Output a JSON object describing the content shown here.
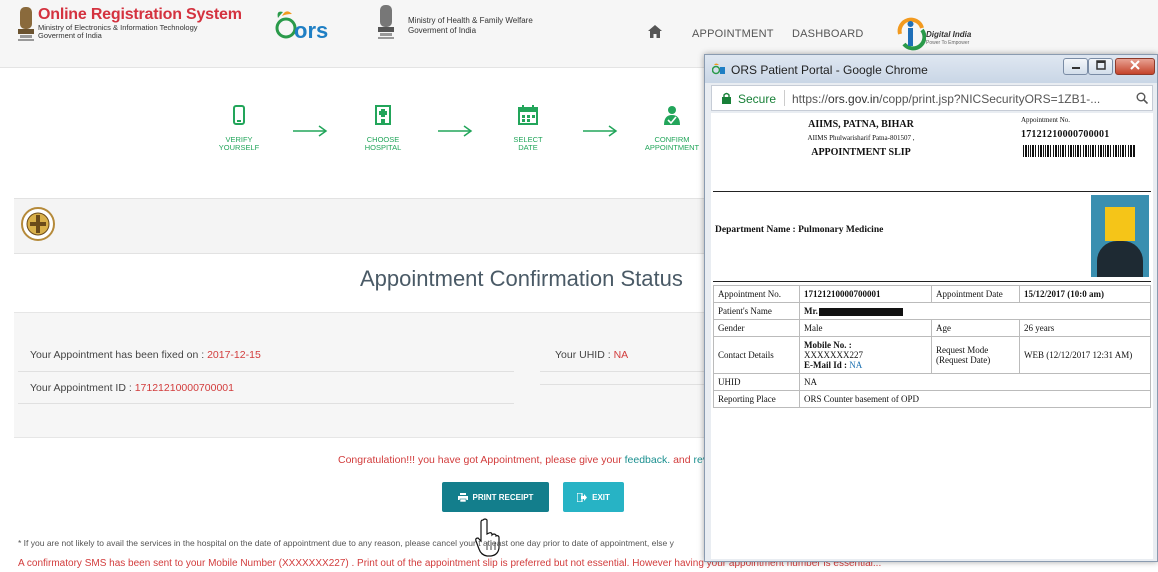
{
  "header": {
    "brand_title": "Online Registration System",
    "brand_sub1": "Ministry of Electronics & Information Technology",
    "brand_sub2": "Goverment of India",
    "ors_logo": "ors",
    "ministry_line1": "Ministry of Health & Family Welfare",
    "ministry_line2": "Goverment of India",
    "nav": {
      "home_icon": "home-icon",
      "appointment": "APPOINTMENT",
      "dashboard": "DASHBOARD"
    },
    "digital_india": "Digital India",
    "digital_india_sub": "Power To Empower"
  },
  "steps": [
    {
      "icon": "mobile-icon",
      "line1": "VERIFY",
      "line2": "YOURSELF"
    },
    {
      "icon": "hospital-icon",
      "line1": "CHOOSE",
      "line2": "HOSPITAL"
    },
    {
      "icon": "calendar-icon",
      "line1": "SELECT",
      "line2": "DATE"
    },
    {
      "icon": "user-check-icon",
      "line1": "CONFIRM",
      "line2": "APPOINTMENT"
    }
  ],
  "confirmation": {
    "title": "Appointment Confirmation Status",
    "fixed_label": "Your Appointment has been fixed on : ",
    "fixed_value": "2017-12-15",
    "id_label": "Your Appointment ID : ",
    "id_value": "17121210000700001",
    "uhid_label": "Your UHID : ",
    "uhid_value": "NA",
    "congrats_text": "Congratulation!!! you have got Appointment, please give your ",
    "feedback_link": "feedback.",
    "congrats_and": " and ",
    "review_link": "revi",
    "print_button": "PRINT RECEIPT",
    "exit_button": "EXIT",
    "note1": "* If you are not likely to avail the services in the hospital on the date of appointment due to any reason, please cancel your                t atleast one day prior to date of appointment, else y",
    "note2": "A confirmatory SMS has been sent to your Mobile Number (XXXXXXX227) . Print out of the appointment slip is preferred but not essential. However having your appointment number is essential..."
  },
  "popup": {
    "window_title": "ORS Patient Portal - Google Chrome",
    "secure_label": "Secure",
    "url_scheme": "https://",
    "url_host": "ors.gov.in",
    "url_path": "/copp/print.jsp?NICSecurityORS=1ZB1-...",
    "slip": {
      "hospital": "AIIMS, PATNA, BIHAR",
      "address": "AIIMS Phulwarisharif Patna-801507 ,",
      "heading": "APPOINTMENT SLIP",
      "appt_no_label": "Appointment No.",
      "appt_no": "17121210000700001",
      "department": "Department Name : Pulmonary Medicine",
      "rows": [
        {
          "l1": "Appointment No.",
          "v1": "17121210000700001",
          "l2": "Appointment Date",
          "v2": "15/12/2017 (10:0 am)"
        },
        {
          "l1": "Patient's Name",
          "v1": "Mr."
        },
        {
          "l1": "Gender",
          "v1": "Male",
          "l2": "Age",
          "v2": "26 years"
        },
        {
          "l1": "Contact Details",
          "v1a": "Mobile No. :",
          "v1b": "XXXXXXX227",
          "v1c": "E-Mail Id : ",
          "v1d": "NA",
          "l2": "Request Mode (Request Date)",
          "v2": "WEB (12/12/2017 12:31 AM)"
        },
        {
          "l1": "UHID",
          "v1": "NA"
        },
        {
          "l1": "Reporting Place",
          "v1": "ORS Counter basement of OPD"
        }
      ]
    }
  },
  "colors": {
    "brand_red": "#d4323f",
    "step_green": "#22a55a",
    "teal_button": "#137e8c",
    "exit_button": "#27b3c5",
    "alert_red": "#d23c3c"
  }
}
